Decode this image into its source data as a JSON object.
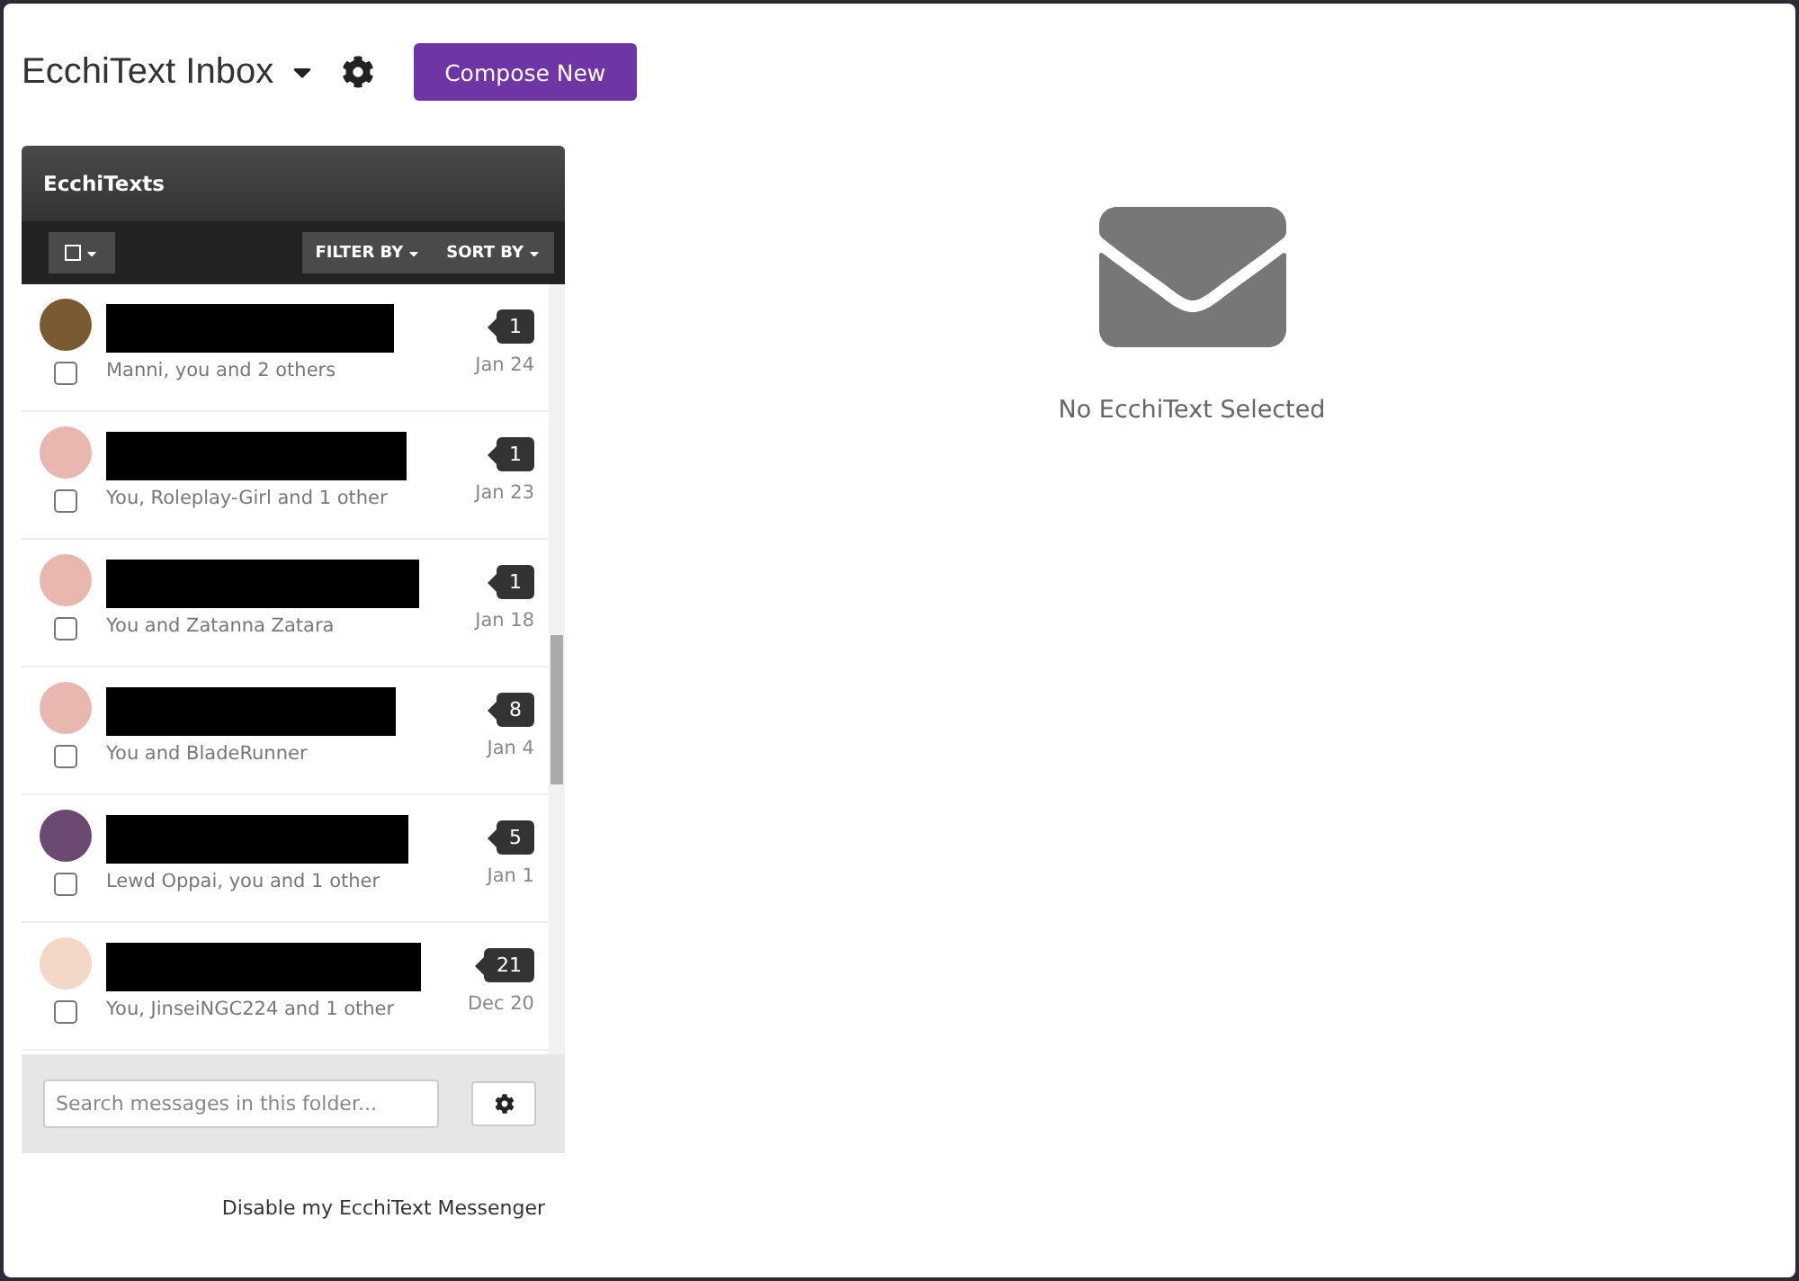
{
  "header": {
    "title": "EcchiText Inbox",
    "compose_button": "Compose New"
  },
  "panel": {
    "title": "EcchiTexts",
    "filter_button": "FILTER BY",
    "sort_button": "SORT BY"
  },
  "conversations": [
    {
      "participants": "Manni, you and 2 others",
      "count": "1",
      "date": "Jan 24",
      "checked": false
    },
    {
      "participants": "You, Roleplay-Girl and 1 other",
      "count": "1",
      "date": "Jan 23",
      "checked": false
    },
    {
      "participants": "You and Zatanna Zatara",
      "count": "1",
      "date": "Jan 18",
      "checked": false
    },
    {
      "participants": "You and BladeRunner",
      "count": "8",
      "date": "Jan 4",
      "checked": false
    },
    {
      "participants": "Lewd Oppai, you and 1 other",
      "count": "5",
      "date": "Jan 1",
      "checked": false
    },
    {
      "participants": "You, JinseiNGC224 and 1 other",
      "count": "21",
      "date": "Dec 20",
      "checked": false
    }
  ],
  "search": {
    "placeholder": "Search messages in this folder..."
  },
  "disable_link": "Disable my EcchiText Messenger",
  "empty_state": "No EcchiText Selected"
}
